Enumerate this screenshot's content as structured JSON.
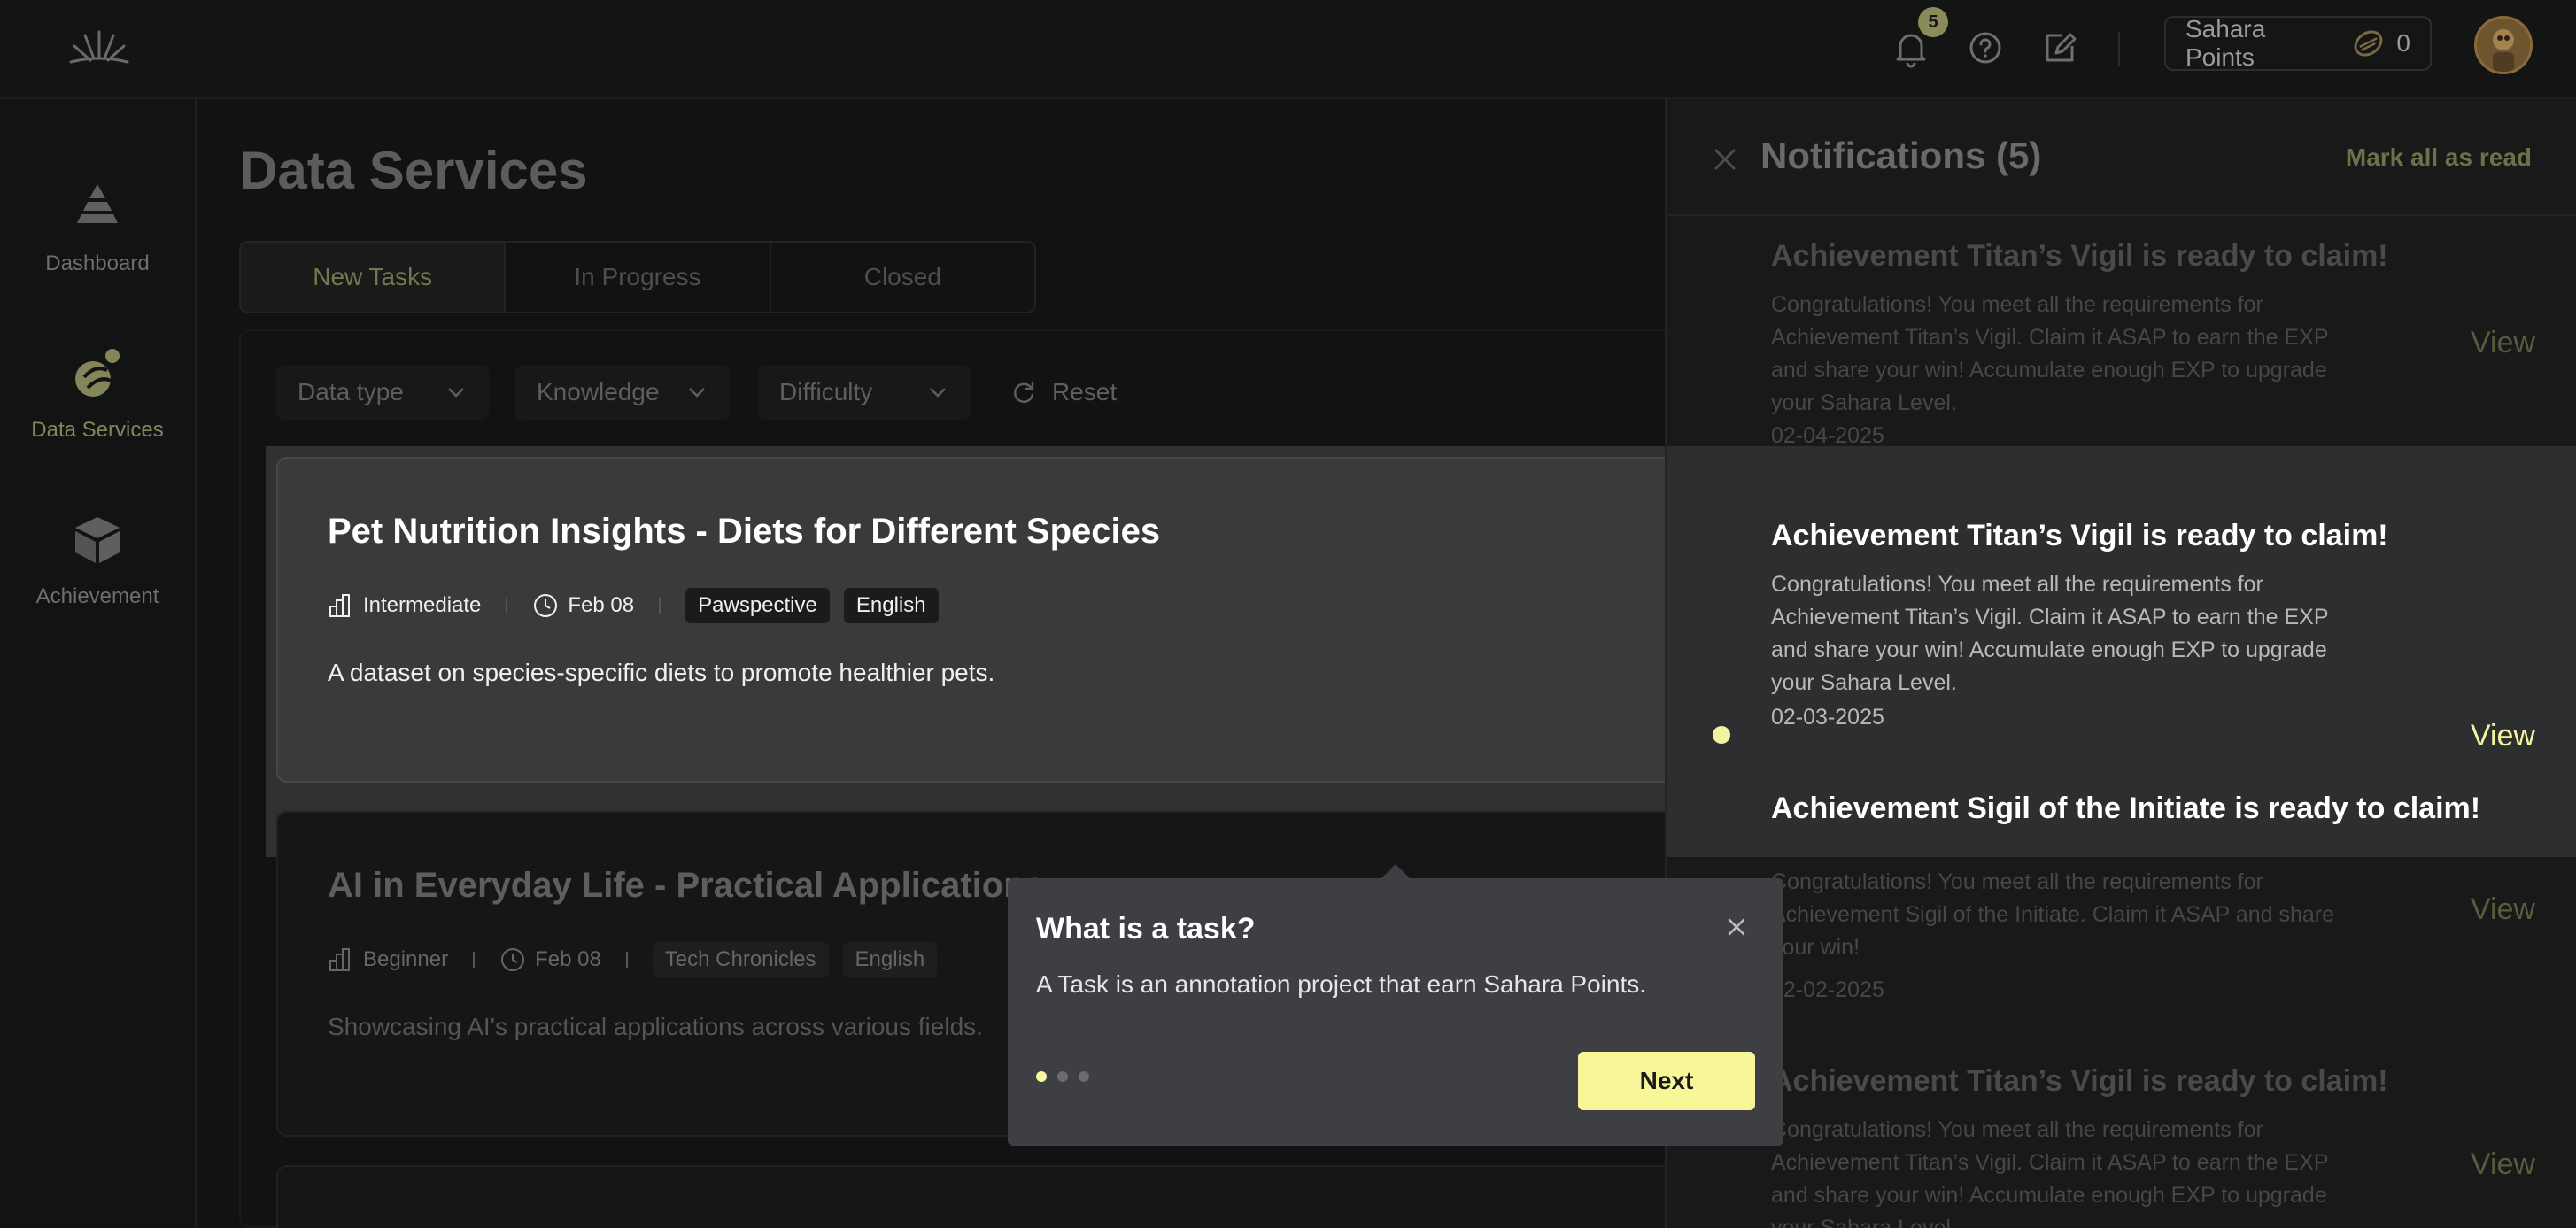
{
  "topbar": {
    "notification_count": "5",
    "points_label": "Sahara Points",
    "points_value": "0",
    "icons": [
      "logo-icon",
      "bell-icon",
      "help-icon",
      "edit-icon",
      "coin-icon",
      "avatar"
    ]
  },
  "sidebar": {
    "items": [
      {
        "label": "Dashboard",
        "icon": "pyramid-icon",
        "active": false
      },
      {
        "label": "Data Services",
        "icon": "data-services-icon",
        "active": true
      },
      {
        "label": "Achievement",
        "icon": "box-icon",
        "active": false
      }
    ]
  },
  "main": {
    "title": "Data Services",
    "tabs": [
      {
        "label": "New Tasks",
        "active": true
      },
      {
        "label": "In Progress",
        "active": false
      },
      {
        "label": "Closed",
        "active": false
      }
    ],
    "filters": {
      "data_type": "Data type",
      "knowledge": "Knowledge",
      "difficulty": "Difficulty",
      "reset": "Reset"
    },
    "tasks": [
      {
        "title": "Pet Nutrition Insights - Diets for Different Species",
        "level": "Intermediate",
        "date": "Feb 08",
        "tags": [
          "Pawspective",
          "English"
        ],
        "description": "A dataset on species-specific diets to promote healthier pets."
      },
      {
        "title": "AI in Everyday Life - Practical Applications",
        "level": "Beginner",
        "date": "Feb 08",
        "tags": [
          "Tech Chronicles",
          "English"
        ],
        "description": "Showcasing AI's practical applications across various fields."
      }
    ]
  },
  "notifications": {
    "title": "Notifications (5)",
    "mark_all": "Mark all as read",
    "view_label": "View",
    "items": [
      {
        "title": "Achievement Titan’s Vigil is ready to claim!",
        "body": "Congratulations! You meet all the requirements for Achievement Titan’s Vigil. Claim it ASAP to earn the EXP and share your win! Accumulate enough EXP to upgrade your Sahara Level.",
        "date": "02-04-2025"
      },
      {
        "title": "Achievement Titan’s Vigil is ready to claim!",
        "body": "Congratulations! You meet all the requirements for Achievement Titan’s Vigil. Claim it ASAP to earn the EXP and share your win! Accumulate enough EXP to upgrade your Sahara Level.",
        "date": "02-03-2025"
      },
      {
        "title": "Achievement Sigil of the Initiate is ready to claim!",
        "body": "Congratulations! You meet all the requirements for Achievement Sigil of the Initiate. Claim it ASAP and share your win!",
        "date": "02-02-2025"
      },
      {
        "title": "Achievement Titan’s Vigil is ready to claim!",
        "body": "Congratulations! You meet all the requirements for Achievement Titan’s Vigil. Claim it ASAP to earn the EXP and share your win! Accumulate enough EXP to upgrade your Sahara Level.",
        "date": ""
      }
    ]
  },
  "tooltip": {
    "title": "What is a task?",
    "body": "A Task is an annotation project that earn Sahara Points.",
    "next": "Next",
    "step": 1,
    "steps": 3
  },
  "colors": {
    "accent": "#f7f79a",
    "accent_dim": "#85855a",
    "background": "#111212"
  }
}
